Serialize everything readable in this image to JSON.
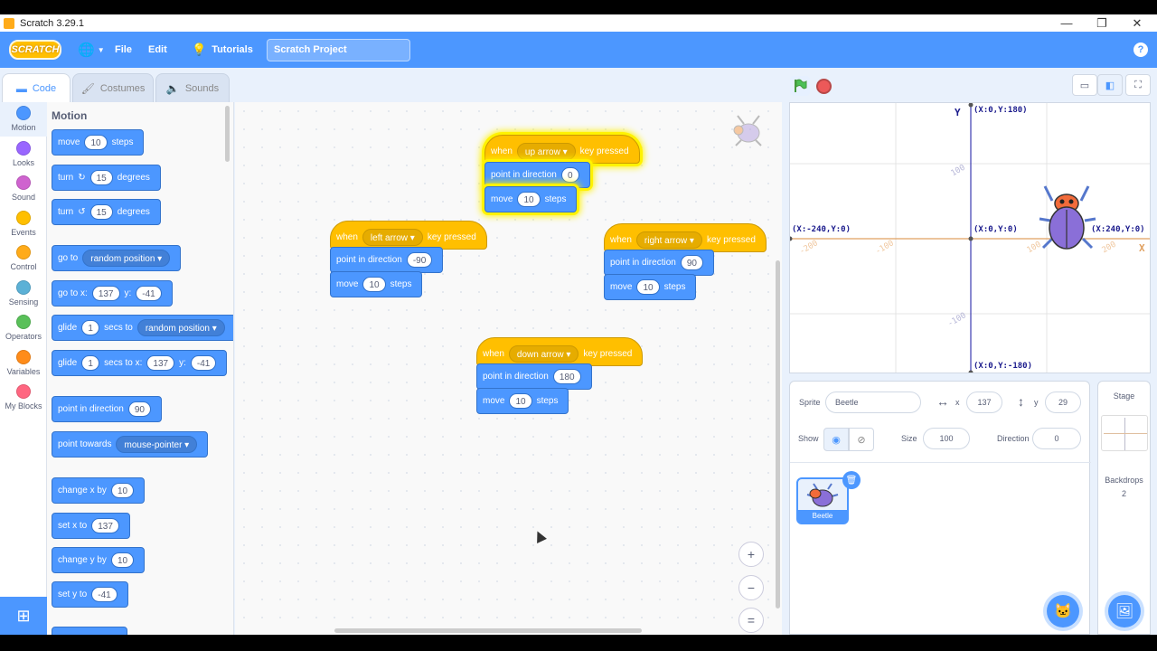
{
  "window": {
    "title": "Scratch 3.29.1",
    "min": "—",
    "restore": "❐",
    "close": "✕"
  },
  "menu": {
    "logo": "SCRATCH",
    "file": "File",
    "edit": "Edit",
    "tutorials": "Tutorials",
    "project_title": "Scratch Project"
  },
  "tabs": {
    "code": "Code",
    "costumes": "Costumes",
    "sounds": "Sounds"
  },
  "categories": [
    {
      "label": "Motion",
      "color": "#4c97ff"
    },
    {
      "label": "Looks",
      "color": "#9966ff"
    },
    {
      "label": "Sound",
      "color": "#cf63cf"
    },
    {
      "label": "Events",
      "color": "#ffbf00"
    },
    {
      "label": "Control",
      "color": "#ffab19"
    },
    {
      "label": "Sensing",
      "color": "#5cb1d6"
    },
    {
      "label": "Operators",
      "color": "#59c059"
    },
    {
      "label": "Variables",
      "color": "#ff8c1a"
    },
    {
      "label": "My Blocks",
      "color": "#ff6680"
    }
  ],
  "palette": {
    "title": "Motion",
    "move": {
      "a": "move",
      "v": "10",
      "b": "steps"
    },
    "turn_r": {
      "a": "turn",
      "v": "15",
      "b": "degrees"
    },
    "turn_l": {
      "a": "turn",
      "v": "15",
      "b": "degrees"
    },
    "goto": {
      "a": "go to",
      "dd": "random position"
    },
    "goto_xy": {
      "a": "go to x:",
      "x": "137",
      "b": "y:",
      "y": "-41"
    },
    "glide": {
      "a": "glide",
      "v": "1",
      "b": "secs to",
      "dd": "random position"
    },
    "glide_xy": {
      "a": "glide",
      "v": "1",
      "b": "secs to x:",
      "x": "137",
      "c": "y:",
      "y": "-41"
    },
    "point_dir": {
      "a": "point in direction",
      "v": "90"
    },
    "point_towards": {
      "a": "point towards",
      "dd": "mouse-pointer"
    },
    "change_x": {
      "a": "change x by",
      "v": "10"
    },
    "set_x": {
      "a": "set x to",
      "v": "137"
    },
    "change_y": {
      "a": "change y by",
      "v": "10"
    },
    "set_y": {
      "a": "set y to",
      "v": "-41"
    }
  },
  "scripts": [
    {
      "when": "when",
      "key": "up arrow",
      "pressed": "key pressed",
      "point": "point in direction",
      "dir": "0",
      "move": "move",
      "steps_v": "10",
      "steps": "steps"
    },
    {
      "when": "when",
      "key": "left arrow",
      "pressed": "key pressed",
      "point": "point in direction",
      "dir": "-90",
      "move": "move",
      "steps_v": "10",
      "steps": "steps"
    },
    {
      "when": "when",
      "key": "right arrow",
      "pressed": "key pressed",
      "point": "point in direction",
      "dir": "90",
      "move": "move",
      "steps_v": "10",
      "steps": "steps"
    },
    {
      "when": "when",
      "key": "down arrow",
      "pressed": "key pressed",
      "point": "point in direction",
      "dir": "180",
      "move": "move",
      "steps_v": "10",
      "steps": "steps"
    }
  ],
  "zoom": {
    "in": "+",
    "out": "−",
    "reset": "="
  },
  "stage": {
    "y_axis": "Y",
    "x_axis": "X",
    "top": "(X:0,Y:180)",
    "bottom": "(X:0,Y:-180)",
    "left": "(X:-240,Y:0)",
    "right": "(X:240,Y:0)",
    "center": "(X:0,Y:0)",
    "t100": "100",
    "tm100": "-100",
    "tx100": "100",
    "txm100": "-100",
    "tx200": "200",
    "txm200": "-200"
  },
  "sprite_info": {
    "sprite_label": "Sprite",
    "sprite_name": "Beetle",
    "x_label": "x",
    "x": "137",
    "y_label": "y",
    "y": "29",
    "show_label": "Show",
    "size_label": "Size",
    "size": "100",
    "direction_label": "Direction",
    "direction": "0"
  },
  "sprites": [
    {
      "name": "Beetle"
    }
  ],
  "stage_pane": {
    "title": "Stage",
    "backdrops_label": "Backdrops",
    "backdrops_count": "2"
  }
}
